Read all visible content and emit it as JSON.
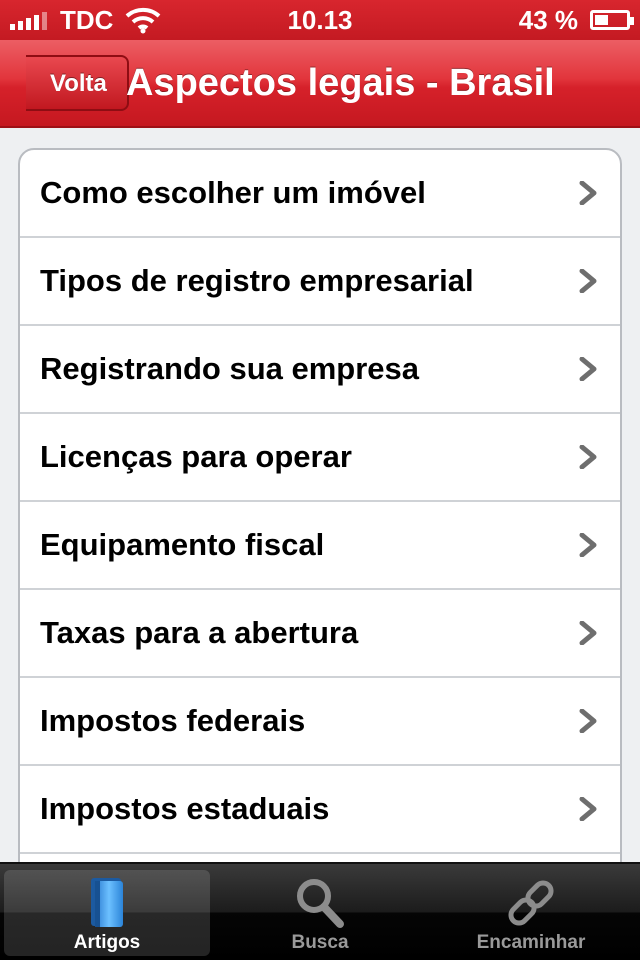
{
  "status_bar": {
    "carrier": "TDC",
    "time": "10.13",
    "battery": "43 %",
    "battery_level": 0.43
  },
  "nav": {
    "back_label": "Volta",
    "title": "Aspectos legais - Brasil"
  },
  "list": {
    "items": [
      {
        "label": "Como escolher um imóvel"
      },
      {
        "label": "Tipos de registro empresarial"
      },
      {
        "label": "Registrando sua empresa"
      },
      {
        "label": "Licenças para operar"
      },
      {
        "label": "Equipamento fiscal"
      },
      {
        "label": "Taxas para a abertura"
      },
      {
        "label": "Impostos federais"
      },
      {
        "label": "Impostos estaduais"
      }
    ]
  },
  "tabs": [
    {
      "label": "Artigos",
      "icon": "book-icon",
      "active": true
    },
    {
      "label": "Busca",
      "icon": "magnifier-icon",
      "active": false
    },
    {
      "label": "Encaminhar",
      "icon": "chain-link-icon",
      "active": false
    }
  ]
}
